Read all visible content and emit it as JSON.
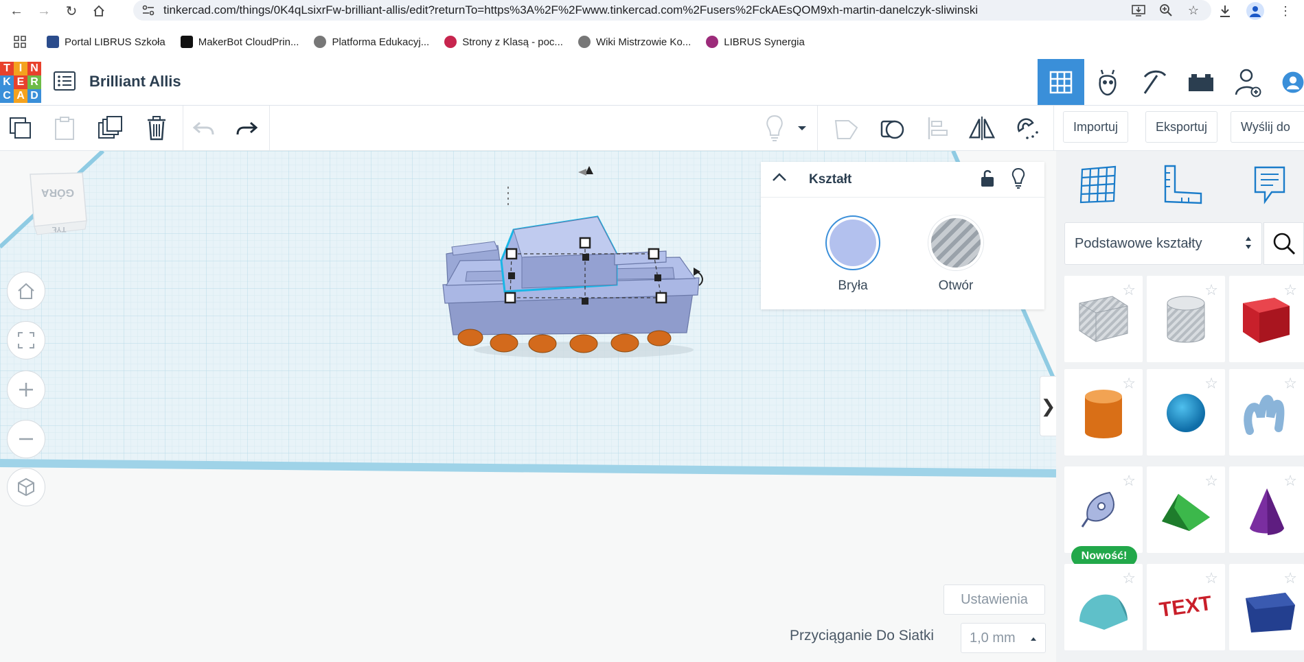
{
  "browser": {
    "url": "tinkercad.com/things/0K4qLsixrFw-brilliant-allis/edit?returnTo=https%3A%2F%2Fwww.tinkercad.com%2Fusers%2FckAEsQOM9xh-martin-danelczyk-sliwinski",
    "bookmarks": [
      {
        "label": "Portal LIBRUS Szkoła",
        "color": "#2b4c8c"
      },
      {
        "label": "MakerBot CloudPrin...",
        "color": "#111111"
      },
      {
        "label": "Platforma Edukacyj...",
        "color": "#666666"
      },
      {
        "label": "Strony z Klasą - poc...",
        "color": "#c7254e"
      },
      {
        "label": "Wiki Mistrzowie Ko...",
        "color": "#666666"
      },
      {
        "label": "LIBRUS Synergia",
        "color": "#9c2b7a"
      }
    ]
  },
  "app": {
    "logo_letters": [
      "T",
      "I",
      "N",
      "K",
      "E",
      "R",
      "C",
      "A",
      "D"
    ],
    "design_title": "Brilliant Allis"
  },
  "toolbar": {
    "import_label": "Importuj",
    "export_label": "Eksportuj",
    "send_label": "Wyślij do"
  },
  "viewcube": {
    "top_label": "GÓRA",
    "back_label": "TYŁ"
  },
  "inspector": {
    "title": "Kształt",
    "solid_label": "Bryła",
    "hole_label": "Otwór",
    "solid_color": "#b3c1ee"
  },
  "footer": {
    "settings_label": "Ustawienia",
    "snap_label": "Przyciąganie Do Siatki",
    "snap_value": "1,0 mm"
  },
  "panel": {
    "shapes_select": "Podstawowe kształty",
    "new_badge": "Nowość!",
    "shapes": [
      {
        "name": "box-hole",
        "color": "#c9ced4"
      },
      {
        "name": "cylinder-hole",
        "color": "#c9ced4"
      },
      {
        "name": "box",
        "color": "#d9232e"
      },
      {
        "name": "cylinder",
        "color": "#e37a1e"
      },
      {
        "name": "sphere",
        "color": "#1a8fcb"
      },
      {
        "name": "scribble",
        "color": "#8ab4d9"
      },
      {
        "name": "shape-generator",
        "color": "#9aaad8"
      },
      {
        "name": "roof",
        "color": "#2fa33f"
      },
      {
        "name": "cone",
        "color": "#7a2ea0"
      },
      {
        "name": "round-roof",
        "color": "#5fc0c9"
      },
      {
        "name": "text",
        "color": "#c91f2a"
      },
      {
        "name": "box-wedge",
        "color": "#233f8f"
      }
    ]
  },
  "colors": {
    "accent": "#3a8fd9",
    "grid_line": "#cfe3ee",
    "selection": "#19b6e6"
  }
}
